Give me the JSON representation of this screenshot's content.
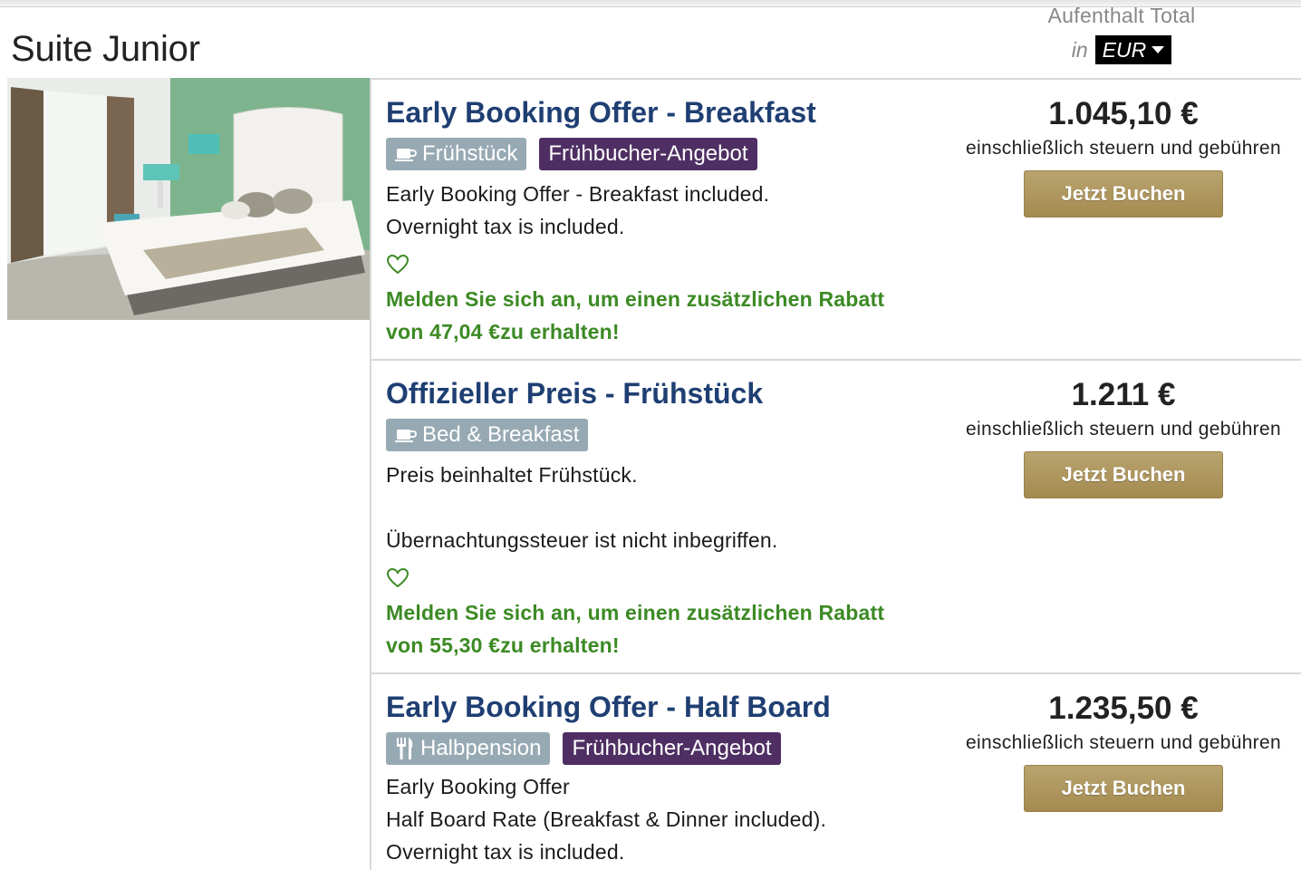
{
  "room": {
    "title": "Suite Junior"
  },
  "header": {
    "stay_total_label": "Aufenthalt Total",
    "in_label": "in",
    "currency": "EUR"
  },
  "rates": [
    {
      "name": "Early Booking Offer - Breakfast",
      "badges": [
        {
          "label": "Frühstück",
          "icon": "coffee-cup-icon",
          "type": "meal"
        },
        {
          "label": "Frühbucher-Angebot",
          "type": "promo"
        }
      ],
      "description": "Early Booking Offer - Breakfast included.\nOvernight tax is included.",
      "discount_line1": "Melden Sie sich an, um einen zusätzlichen Rabatt",
      "discount_line2": "von 47,04 €zu erhalten!",
      "price": "1.045,10 €",
      "price_note": "einschließlich steuern und gebühren",
      "button_label": "Jetzt Buchen"
    },
    {
      "name": "Offizieller Preis - Frühstück",
      "badges": [
        {
          "label": "Bed & Breakfast",
          "icon": "coffee-cup-icon",
          "type": "meal"
        }
      ],
      "description": "Preis beinhaltet Frühstück.\n\nÜbernachtungssteuer ist nicht inbegriffen.",
      "discount_line1": "Melden Sie sich an, um einen zusätzlichen Rabatt",
      "discount_line2": "von 55,30 €zu erhalten!",
      "price": "1.211 €",
      "price_note": "einschließlich steuern und gebühren",
      "button_label": "Jetzt Buchen"
    },
    {
      "name": "Early Booking Offer - Half Board",
      "badges": [
        {
          "label": "Halbpension",
          "icon": "fork-knife-icon",
          "type": "meal"
        },
        {
          "label": "Frühbucher-Angebot",
          "type": "promo"
        }
      ],
      "description": "Early Booking Offer\nHalf Board Rate (Breakfast & Dinner included).\nOvernight tax is included.",
      "price": "1.235,50 €",
      "price_note": "einschließlich steuern und gebühren",
      "button_label": "Jetzt Buchen"
    }
  ],
  "colors": {
    "rate_title": "#1f3f73",
    "discount_green": "#3c8a24",
    "meal_badge": "#97a9b3",
    "promo_badge": "#4f2f63",
    "book_button": "#a48a50"
  }
}
